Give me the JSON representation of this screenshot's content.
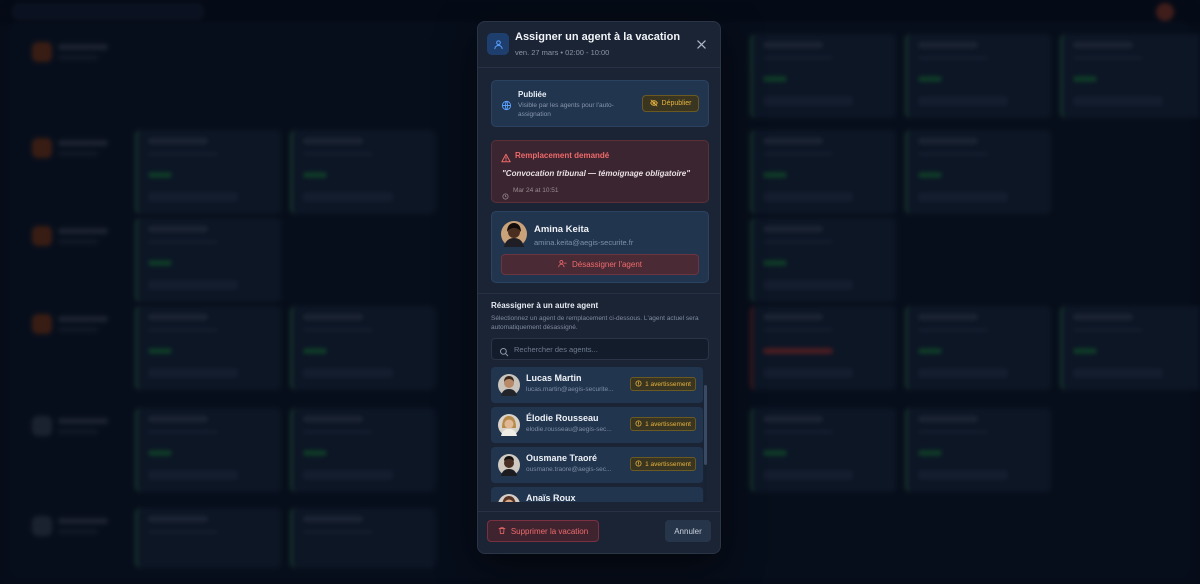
{
  "modal": {
    "title": "Assigner un agent à la vacation",
    "subtitle": "ven. 27 mars • 02:00 - 10:00"
  },
  "published": {
    "title": "Publiée",
    "description": "Visible par les agents pour l'auto-assignation",
    "unpublish_label": "Dépublier"
  },
  "replacement": {
    "title": "Remplacement demandé",
    "reason": "\"Convocation tribunal — témoignage obligatoire\"",
    "requested_at": "Mar 24 at 10:51"
  },
  "assigned_agent": {
    "name": "Amina Keita",
    "email": "amina.keita@aegis-securite.fr",
    "unassign_label": "Désassigner l'agent"
  },
  "reassign": {
    "title": "Réassigner à un autre agent",
    "description": "Sélectionnez un agent de remplacement ci-dessous. L'agent actuel sera automatiquement désassigné.",
    "search_placeholder": "Rechercher des agents..."
  },
  "agents": [
    {
      "name": "Lucas Martin",
      "email": "lucas.martin@aegis-securite...",
      "badge": "1 avertissement"
    },
    {
      "name": "Élodie Rousseau",
      "email": "elodie.rousseau@aegis-sec...",
      "badge": "1 avertissement"
    },
    {
      "name": "Ousmane Traoré",
      "email": "ousmane.traore@aegis-sec...",
      "badge": "1 avertissement"
    },
    {
      "name": "Anaïs Roux",
      "email": "",
      "badge": ""
    }
  ],
  "footer": {
    "delete_label": "Supprimer la vacation",
    "cancel_label": "Annuler"
  },
  "colors": {
    "accent_danger": "#f06a6a",
    "accent_warning": "#e7b43f",
    "accent_primary": "#2f6fd6"
  },
  "icons": {
    "header": "user-icon",
    "close": "close-icon",
    "published": "globe-icon",
    "unpublish": "eye-off-icon",
    "replacement": "warning-triangle-icon",
    "time": "clock-icon",
    "unassign": "user-minus-icon",
    "search": "search-icon",
    "badge": "alert-circle-icon",
    "delete": "trash-icon"
  }
}
